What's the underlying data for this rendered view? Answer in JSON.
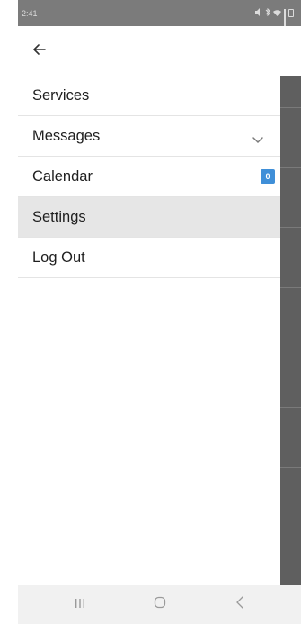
{
  "status_bar": {
    "time": "2:41",
    "icons": [
      "mute-icon",
      "bluetooth-icon",
      "wifi-icon",
      "signal-icon",
      "battery-icon"
    ]
  },
  "app_bar": {
    "back_icon": "arrow-left-icon"
  },
  "menu": {
    "items": [
      {
        "label": "Services"
      },
      {
        "label": "Messages",
        "icon": "chevron-down-icon"
      },
      {
        "label": "Calendar",
        "badge": "0"
      },
      {
        "label": "Settings",
        "selected": true
      },
      {
        "label": "Log Out"
      }
    ]
  },
  "bottom_nav": {
    "buttons": [
      "recents-icon",
      "home-icon",
      "back-icon"
    ]
  },
  "colors": {
    "status_bar": "#7b7b7b",
    "badge": "#3f8fd8",
    "selected_row": "#e6e6e6",
    "scrim": "#5f5f5f",
    "nav_bar": "#f1f1f1"
  }
}
